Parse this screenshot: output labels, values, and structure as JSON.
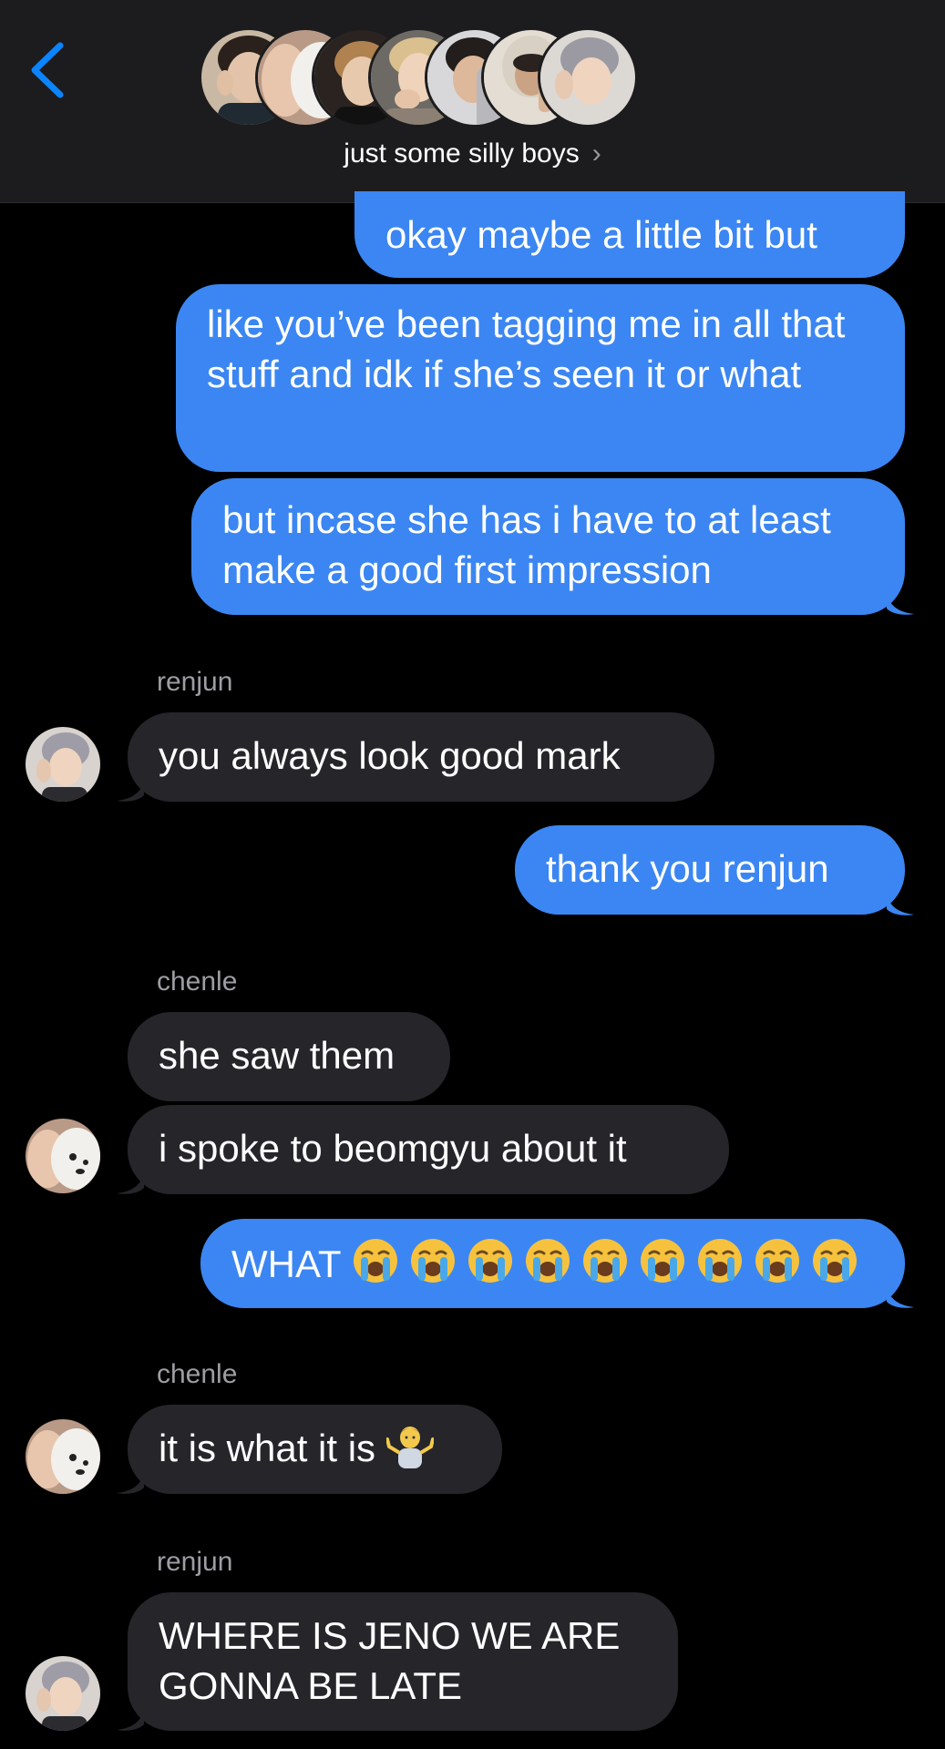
{
  "header": {
    "back_icon": "chevron-left-icon",
    "group_name": "just some silly boys",
    "chevron_icon": "chevron-right-icon",
    "accent_color": "#0a84ff",
    "member_avatar_count": 7
  },
  "messages": [
    {
      "from": "me",
      "text": "okay maybe a little bit but"
    },
    {
      "from": "me",
      "text": "like you’ve been tagging me in all that stuff and idk if she’s seen it or what"
    },
    {
      "from": "me",
      "text": "but incase she has i have to at least make a good first impression"
    },
    {
      "sender": "renjun",
      "text": "you always look good mark"
    },
    {
      "from": "me",
      "text": "thank you renjun"
    },
    {
      "sender": "chenle",
      "text": "she saw them"
    },
    {
      "sender": "chenle",
      "text": "i spoke to beomgyu about it"
    },
    {
      "from": "me",
      "text": "WHAT",
      "emoji": "loudly-crying-face-icon",
      "emoji_count": 9
    },
    {
      "sender": "chenle",
      "text": "it is what it is",
      "emoji": "person-shrugging-icon"
    },
    {
      "sender": "renjun",
      "text": "WHERE IS JENO WE ARE GONNA BE LATE"
    }
  ],
  "colors": {
    "outgoing_bubble": "#3b86f2",
    "incoming_bubble": "#26252a",
    "header_bg": "#1c1c1e",
    "sender_label": "#9d9da3"
  }
}
